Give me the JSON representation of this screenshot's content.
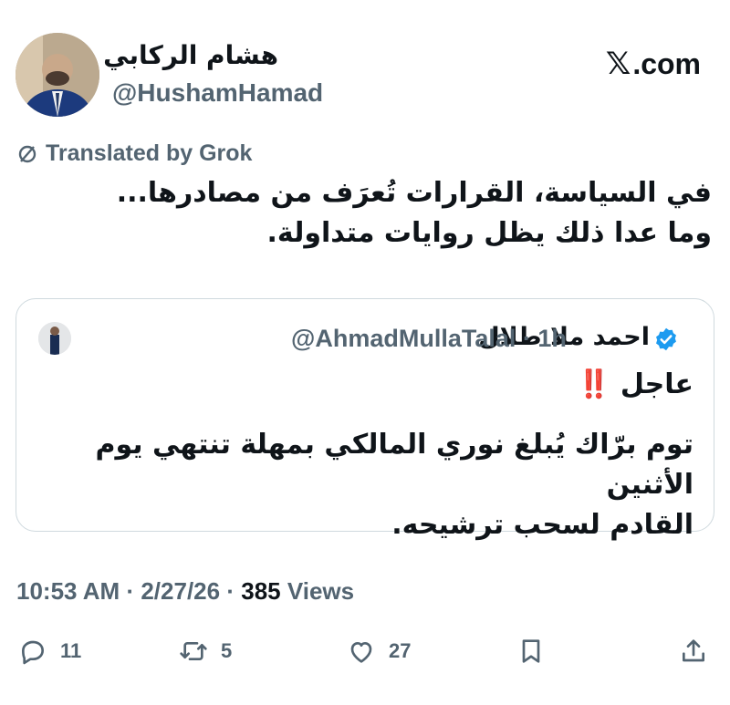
{
  "author": {
    "display_name": "هشام الركابي",
    "handle": "@HushamHamad"
  },
  "brand": {
    "x_glyph": "𝕏",
    "domain_label": ".com"
  },
  "translation": {
    "label": "Translated by Grok"
  },
  "tweet": {
    "line1": "في السياسة، القرارات تُعرَف من مصادرها...",
    "line2": "وما عدا ذلك يظل روايات متداولة."
  },
  "quote": {
    "display_name": "احمد ملا طلال",
    "handle": "@AhmadMullaTalal",
    "separator": "·",
    "age": "1h",
    "urgent_label": "عاجل",
    "urgent_mark": "‼️",
    "body_line1": "توم برّاك يُبلغ نوري المالكي بمهلة تنتهي يوم الأثنين",
    "body_line2": "القادم لسحب ترشيحه."
  },
  "meta": {
    "time": "10:53 AM",
    "sep1": "·",
    "date": "2/27/26",
    "sep2": "·",
    "views": "385",
    "views_label": "Views"
  },
  "actions": {
    "replies": "11",
    "reposts": "5",
    "likes": "27"
  },
  "colors": {
    "text": "#0f1419",
    "secondary": "#536471",
    "border": "#cfd9de",
    "verified": "#1d9bf0",
    "urgent": "#e0245e"
  },
  "icons": [
    "reply-icon",
    "repost-icon",
    "like-icon",
    "bookmark-icon",
    "share-icon",
    "verified-icon",
    "translate-icon"
  ]
}
